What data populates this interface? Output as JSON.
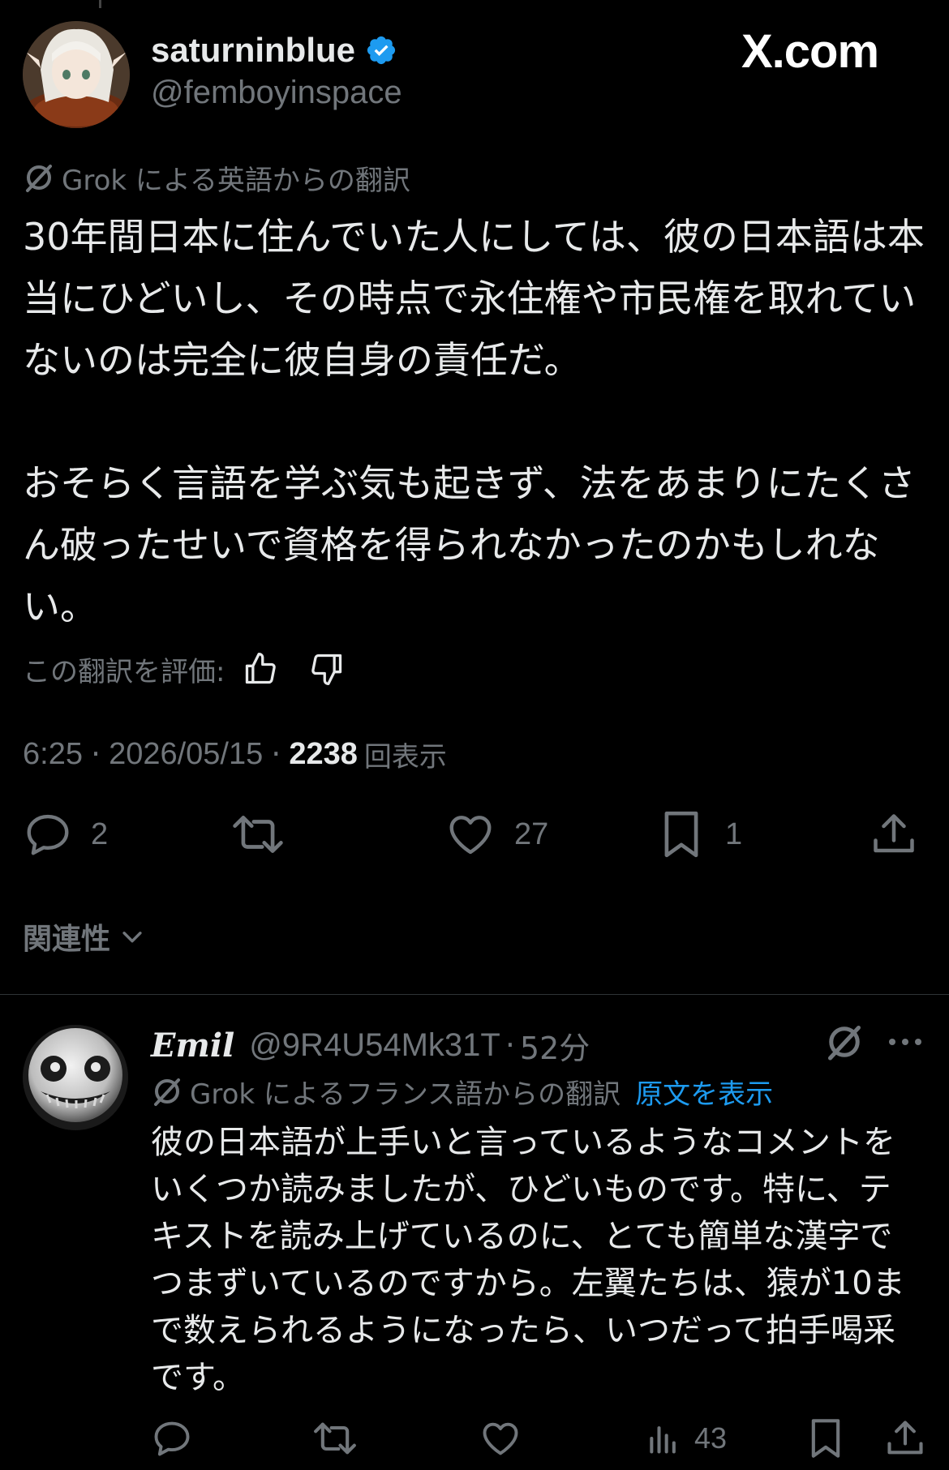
{
  "watermark": "X.com",
  "tweet": {
    "display_name": "saturninblue",
    "handle": "@femboyinspace",
    "translation_note": "Grok による英語からの翻訳",
    "paragraph1": "30年間日本に住んでいた人にしては、彼の日本語は本当にひどいし、その時点で永住権や市民権を取れていないのは完全に彼自身の責任だ。",
    "paragraph2": "おそらく言語を学ぶ気も起きず、法をあまりにたくさん破ったせいで資格を得られなかったのかもしれない。",
    "rate_label": "この翻訳を評価:",
    "time": "6:25",
    "date": "2026/05/15",
    "views_count": "2238",
    "views_label": "回表示",
    "replies": "2",
    "likes": "27",
    "bookmarks": "1"
  },
  "sort": {
    "label": "関連性"
  },
  "reply": {
    "display_name": "Emil",
    "handle": "@9R4U54Mk31T",
    "age": "52分",
    "translation_note": "Grok によるフランス語からの翻訳",
    "show_original": "原文を表示",
    "text": "彼の日本語が上手いと言っているようなコメントをいくつか読みましたが、ひどいものです。特に、テキストを読み上げているのに、とても簡単な漢字でつまずいているのですから。左翼たちは、猿が10まで数えられるようになったら、いつだって拍手喝采です。",
    "views": "43"
  },
  "colors": {
    "accent": "#1d9bf0",
    "muted": "#71767b",
    "text": "#e7e9ea"
  }
}
